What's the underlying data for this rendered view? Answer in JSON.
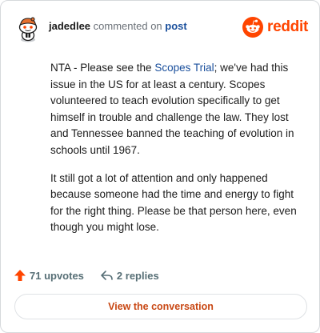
{
  "header": {
    "username": "jadedlee",
    "action_text": "commented on",
    "target_text": "post",
    "brand_name": "reddit",
    "avatar_icon": "snoo-avatar-icon",
    "brand_icon": "reddit-logo-icon"
  },
  "comment": {
    "p1_before": "NTA - Please see the ",
    "p1_link": "Scopes Trial",
    "p1_after": "; we've had this issue in the US for at least a century. Scopes volunteered to teach evolution specifically to get himself in trouble and challenge the law. They lost and Tennessee banned the teaching of evolution in schools until 1967.",
    "p2": "It still got a lot of attention and only happened because someone had the time and energy to fight for the right thing. Please be that person here, even though you might lose."
  },
  "stats": {
    "upvotes_label": "71 upvotes",
    "replies_label": "2 replies",
    "upvote_icon": "upvote-arrow-icon",
    "reply_icon": "reply-arrow-icon"
  },
  "cta": {
    "label": "View the conversation"
  },
  "colors": {
    "accent": "#ff4500",
    "link": "#1a4f9c",
    "cta_text": "#c84713",
    "muted": "#576f76",
    "border": "#d6d9dc"
  }
}
